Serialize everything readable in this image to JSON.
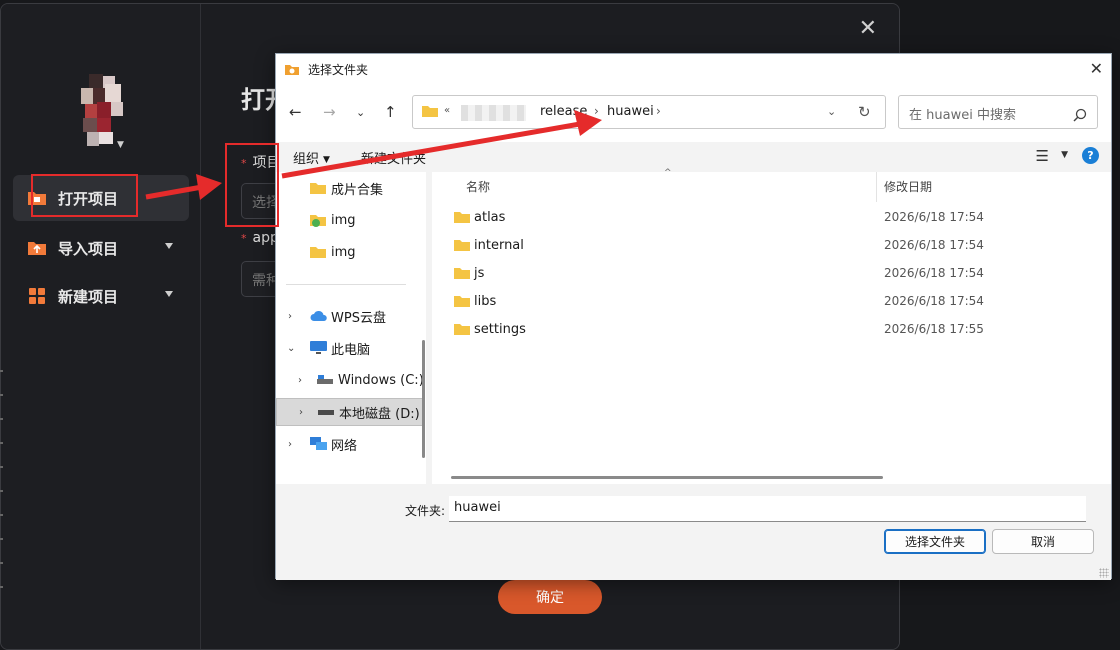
{
  "app": {
    "title": "打开",
    "close_glyph": "✕",
    "nav": [
      {
        "label": "打开项目",
        "icon": "folder-open-icon",
        "active": true
      },
      {
        "label": "导入项目",
        "icon": "import-folder-icon",
        "has_dropdown": true
      },
      {
        "label": "新建项目",
        "icon": "grid-apps-icon",
        "has_dropdown": true
      }
    ],
    "form": {
      "project_label": "项目",
      "project_placeholder": "选择",
      "app_label": "app",
      "app_placeholder": "需种",
      "required_mark": "*"
    },
    "confirm_label": "确定",
    "accent": "#d9582b"
  },
  "dialog": {
    "title": "选择文件夹",
    "close_glyph": "✕",
    "address": {
      "overflow": "«",
      "segments": [
        "release",
        "huawei"
      ],
      "separator": "›"
    },
    "search_placeholder": "在 huawei 中搜索",
    "toolbar": {
      "organize": "组织",
      "new_folder": "新建文件夹",
      "help": "?"
    },
    "tree": [
      {
        "label": "成片合集",
        "icon": "folder-icon"
      },
      {
        "label": "img",
        "icon": "image-folder-icon"
      },
      {
        "label": "img",
        "icon": "folder-icon"
      },
      {
        "label": "WPS云盘",
        "icon": "cloud-icon",
        "expandable": true
      },
      {
        "label": "此电脑",
        "icon": "computer-icon",
        "expanded": true
      },
      {
        "label": "Windows (C:)",
        "icon": "drive-icon",
        "expandable": true
      },
      {
        "label": "本地磁盘 (D:)",
        "icon": "drive-icon",
        "expandable": true,
        "selected": true
      },
      {
        "label": "网络",
        "icon": "network-icon",
        "expandable": true
      }
    ],
    "columns": {
      "name": "名称",
      "modified": "修改日期"
    },
    "files": [
      {
        "name": "atlas",
        "modified": "2026/6/18 17:54"
      },
      {
        "name": "internal",
        "modified": "2026/6/18 17:54"
      },
      {
        "name": "js",
        "modified": "2026/6/18 17:54"
      },
      {
        "name": "libs",
        "modified": "2026/6/18 17:54"
      },
      {
        "name": "settings",
        "modified": "2026/6/18 17:55"
      }
    ],
    "folder_field_label": "文件夹:",
    "folder_field_value": "huawei",
    "select_button": "选择文件夹",
    "cancel_button": "取消",
    "accent": "#1a7fd6"
  },
  "annotation_color": "#e52b2b"
}
